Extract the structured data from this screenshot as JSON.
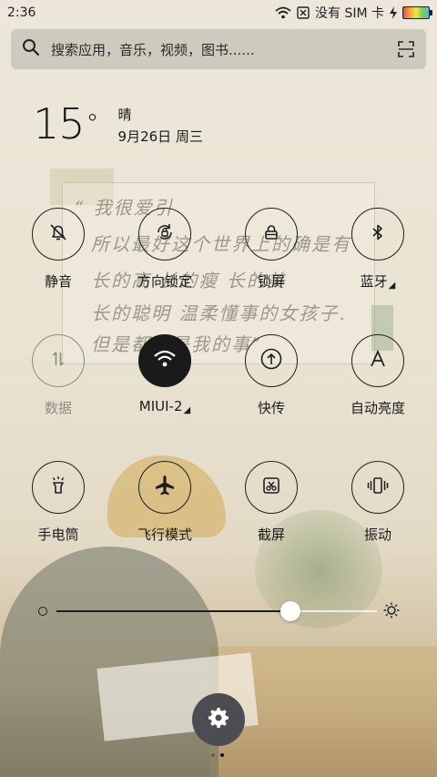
{
  "status_bar": {
    "time": "2:36",
    "carrier": "没有 SIM 卡",
    "icons": [
      "wifi-icon",
      "no-sim-icon",
      "charging-icon",
      "battery-icon"
    ]
  },
  "search": {
    "placeholder": "搜索应用，音乐，视频，图书......",
    "icons": [
      "search-icon",
      "scan-icon"
    ]
  },
  "weather": {
    "temperature": "15",
    "degree": "°",
    "condition": "晴",
    "date": "9月26日 周三"
  },
  "toggles": [
    {
      "label": "静音",
      "icon": "bell-off-icon",
      "state": "off"
    },
    {
      "label": "方向锁定",
      "icon": "rotation-lock-icon",
      "state": "off"
    },
    {
      "label": "锁屏",
      "icon": "lock-icon",
      "state": "off"
    },
    {
      "label": "蓝牙",
      "icon": "bluetooth-icon",
      "state": "off",
      "has_more": true
    },
    {
      "label": "数据",
      "icon": "data-arrows-icon",
      "state": "disabled"
    },
    {
      "label": "MIUI-2",
      "icon": "wifi-icon",
      "state": "on",
      "has_more": true
    },
    {
      "label": "快传",
      "icon": "transfer-icon",
      "state": "off"
    },
    {
      "label": "自动亮度",
      "icon": "letter-a-icon",
      "state": "off"
    },
    {
      "label": "手电筒",
      "icon": "flashlight-icon",
      "state": "off"
    },
    {
      "label": "飞行模式",
      "icon": "airplane-icon",
      "state": "off"
    },
    {
      "label": "截屏",
      "icon": "screenshot-icon",
      "state": "off"
    },
    {
      "label": "振动",
      "icon": "vibrate-icon",
      "state": "off"
    }
  ],
  "brightness": {
    "level": 0.73,
    "icons": [
      "brightness-low-icon",
      "brightness-high-icon"
    ]
  },
  "settings": {
    "icon": "gear-icon"
  },
  "pager": {
    "pages": 2,
    "current": 2
  },
  "colors": {
    "toggle_active_bg": "#1a1a1a",
    "toggle_border": "#1e1e1e",
    "disabled": "#8b8b86",
    "settings_bg": "#4c4d52",
    "search_bg": "#c8c5b9"
  },
  "wallpaper": {
    "handwriting": [
      "“ 我很爱引",
      "所以最好这个世界上的确是有",
      "长的高 长的瘦 长的美",
      "长的聪明 温柔懂事的女孩子.",
      "但是都不是我的事”"
    ]
  }
}
